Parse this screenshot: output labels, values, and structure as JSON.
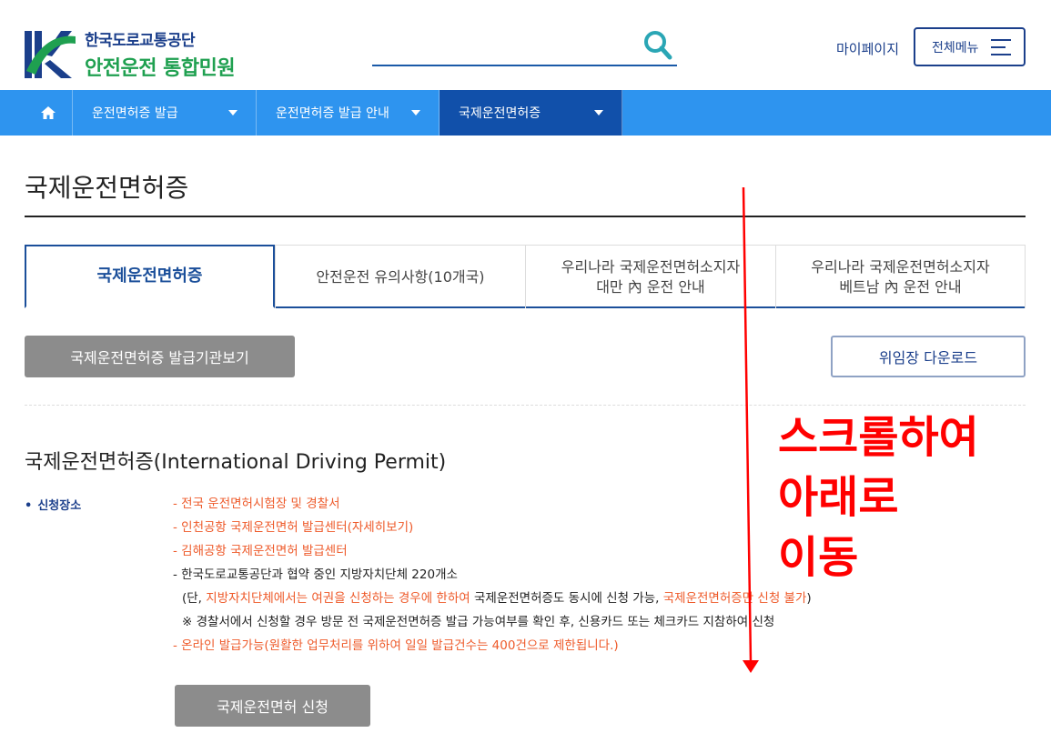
{
  "header": {
    "logo_line1": "한국도로교통공단",
    "logo_line2": "안전운전 통합민원",
    "search_icon": "search-icon",
    "mypage": "마이페이지",
    "allmenu": "전체메뉴"
  },
  "nav": {
    "home_icon": "home-icon",
    "items": [
      {
        "label": "운전면허증 발급"
      },
      {
        "label": "운전면허증 발급 안내"
      },
      {
        "label": "국제운전면허증"
      }
    ]
  },
  "page": {
    "title": "국제운전면허증"
  },
  "tabs": [
    {
      "label": "국제운전면허증"
    },
    {
      "label": "안전운전 유의사항(10개국)"
    },
    {
      "line1": "우리나라 국제운전면허소지자",
      "line2": "대만 內 운전 안내"
    },
    {
      "line1": "우리나라 국제운전면허소지자",
      "line2": "베트남 內 운전 안내"
    }
  ],
  "buttons": {
    "issuers": "국제운전면허증 발급기관보기",
    "download": "위임장 다운로드",
    "apply": "국제운전면허 신청"
  },
  "section": {
    "title": "국제운전면허증(International Driving Permit)",
    "bullet_label": "신청장소",
    "line1": "- 전국 운전면허시험장 및 경찰서",
    "line2": "- 인천공항 국제운전면허 발급센터(자세히보기)",
    "line3": "- 김해공항 국제운전면허 발급센터",
    "line4": "- 한국도로교통공단과 협약 중인 지방자치단체 220개소",
    "line5_a": "(단, ",
    "line5_b": "지방자치단체에서는 여권을 신청하는 경우에 한하여",
    "line5_c": " 국제운전면허증도 동시에 신청 가능, ",
    "line5_d": "국제운전면허증만 신청 불가",
    "line5_e": ")",
    "line6": "※ 경찰서에서 신청할 경우 방문 전 국제운전면허증 발급 가능여부를 확인 후, 신용카드 또는 체크카드 지참하여 신청",
    "line7": "- 온라인 발급가능(원활한 업무처리를 위하여 일일 발급건수는 400건으로 제한됩니다.)"
  },
  "annotation": {
    "line1": "스크롤하여",
    "line2": "아래로",
    "line3": "이동"
  },
  "colors": {
    "nav_bg": "#2e94ef",
    "nav_active": "#1150aa",
    "brand_blue": "#1b3f8b",
    "brand_green": "#1fa050",
    "orange_text": "#ee5a2a",
    "annotation_red": "#ff0000"
  }
}
